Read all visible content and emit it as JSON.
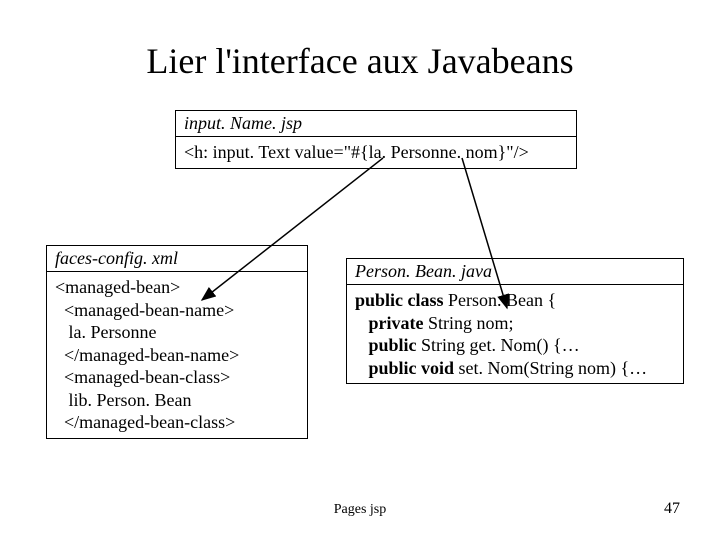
{
  "title": "Lier l'interface aux Javabeans",
  "top_box": {
    "header": "input. Name. jsp",
    "body": "<h: input. Text value=\"#{la. Personne. nom}\"/>"
  },
  "left_box": {
    "header": "faces-config. xml",
    "body": "<managed-bean>\n  <managed-bean-name>\n   la. Personne\n  </managed-bean-name>\n  <managed-bean-class>\n   lib. Person. Bean\n  </managed-bean-class>"
  },
  "right_box": {
    "header": "Person. Bean. java",
    "body_html": "<b>public class</b> Person. Bean {\n   <b>private</b> String nom;\n   <b>public</b> String get. Nom() {…\n   <b>public void</b> set. Nom(String nom) {…"
  },
  "footer": {
    "center": "Pages jsp",
    "page": "47"
  }
}
